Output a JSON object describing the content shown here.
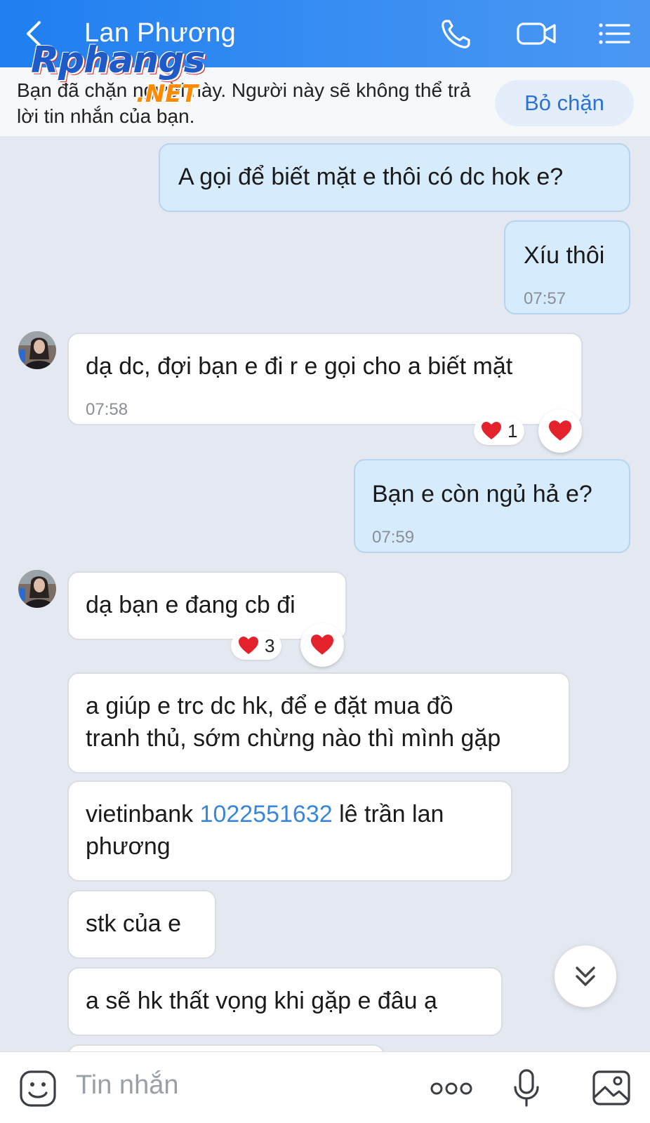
{
  "header": {
    "title": "Lan Phương"
  },
  "watermark": {
    "main": "Rphangs",
    "sub": ".NET"
  },
  "blocked_banner": {
    "text": "Bạn đã chặn người này. Người này sẽ không thể trả lời tin nhắn của bạn.",
    "unblock_label": "Bỏ chặn"
  },
  "messages": [
    {
      "direction": "out",
      "text": "A gọi để biết mặt e thôi có dc hok e?"
    },
    {
      "direction": "out",
      "text": "Xíu thôi",
      "time": "07:57"
    },
    {
      "direction": "in",
      "text": "dạ dc, đợi bạn e đi r e gọi cho a biết mặt",
      "time": "07:58",
      "reaction_count": "1"
    },
    {
      "direction": "out",
      "text": "Bạn e còn ngủ hả e?",
      "time": "07:59"
    },
    {
      "direction": "in",
      "text": "dạ bạn e đang cb đi",
      "reaction_count": "3"
    },
    {
      "direction": "in",
      "text_line1": "a giúp e trc dc hk, để e đặt mua đồ",
      "text_line2": "tranh thủ, sớm chừng nào thì mình gặp"
    },
    {
      "direction": "in",
      "text_before": "vietinbank ",
      "account_number": "1022551632",
      "text_after": " lê trần lan",
      "text_line2": "phương"
    },
    {
      "direction": "in",
      "text": "stk của e"
    },
    {
      "direction": "in",
      "text": "a sẽ hk thất vọng khi gặp e đâu ạ"
    }
  ],
  "input_bar": {
    "placeholder": "Tin nhắn"
  },
  "colors": {
    "header": "#2f86f1",
    "outgoing_bubble": "#d6ebfb",
    "incoming_bubble": "#ffffff",
    "link": "#3a86dd",
    "heart": "#e3222c"
  }
}
